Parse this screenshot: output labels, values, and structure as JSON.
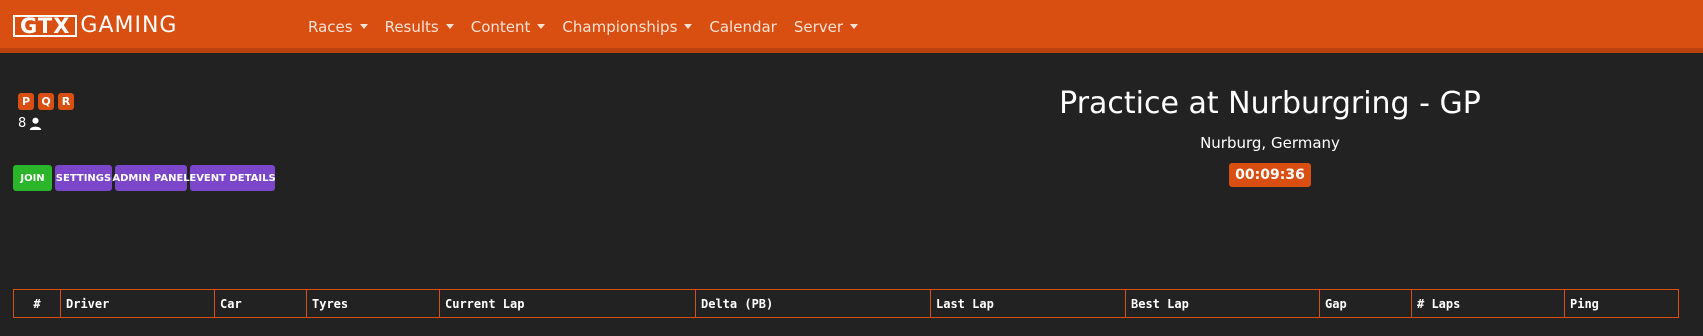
{
  "brand": {
    "logo_box": "GTX",
    "logo_text": "GAMING"
  },
  "nav": [
    {
      "label": "Races",
      "dropdown": true
    },
    {
      "label": "Results",
      "dropdown": true
    },
    {
      "label": "Content",
      "dropdown": true
    },
    {
      "label": "Championships",
      "dropdown": true
    },
    {
      "label": "Calendar",
      "dropdown": false
    },
    {
      "label": "Server",
      "dropdown": true
    }
  ],
  "sessions": [
    "P",
    "Q",
    "R"
  ],
  "player_count": "8",
  "actions": {
    "join": "JOIN",
    "settings": "SETTINGS",
    "admin": "ADMIN PANEL",
    "details": "EVENT DETAILS"
  },
  "event": {
    "title": "Practice at Nurburgring - GP",
    "location": "Nurburg, Germany",
    "timer": "00:09:36"
  },
  "table": {
    "headers": [
      "#",
      "Driver",
      "Car",
      "Tyres",
      "Current Lap",
      "Delta (PB)",
      "Last Lap",
      "Best Lap",
      "Gap",
      "# Laps",
      "Ping"
    ]
  },
  "colors": {
    "accent": "#d94f12",
    "background": "#222222",
    "join": "#2ab52a",
    "purple": "#7b46c9"
  }
}
